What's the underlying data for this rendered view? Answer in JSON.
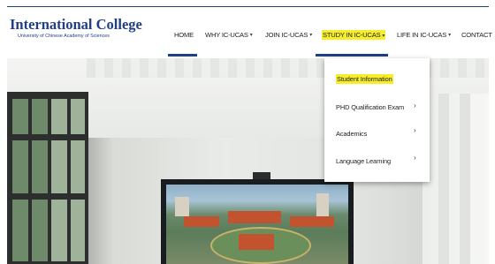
{
  "logo": {
    "title": "International College",
    "subtitle": "University of Chinese Academy of Sciences"
  },
  "nav": {
    "home": "HOME",
    "why": "WHY IC-UCAS",
    "join": "JOIN IC-UCAS",
    "study": "STUDY IN IC-UCAS",
    "life": "LIFE IN IC-UCAS",
    "contact": "CONTACT"
  },
  "dropdown": {
    "items": [
      {
        "label": "Student Information",
        "has_submenu": false,
        "highlighted": true
      },
      {
        "label": "PHD Qualification Exam",
        "has_submenu": true
      },
      {
        "label": "Academics",
        "has_submenu": true
      },
      {
        "label": "Language Learning",
        "has_submenu": true
      }
    ]
  },
  "colors": {
    "brand_blue": "#1f3f86",
    "highlight": "#f7ee2a"
  },
  "icons": {
    "caret": "chevron-down-icon",
    "submenu": "chevron-right-icon"
  }
}
